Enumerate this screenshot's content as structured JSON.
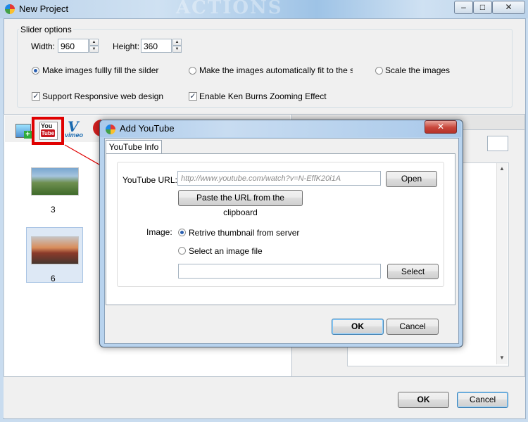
{
  "window": {
    "title": "New Project",
    "watermark": "ACTIONS",
    "controls": {
      "minimize": "–",
      "maximize": "□",
      "close": "✕"
    }
  },
  "slider_options": {
    "legend": "Slider options",
    "width_label": "Width:",
    "width_value": "960",
    "height_label": "Height:",
    "height_value": "360",
    "fit_options": [
      {
        "label": "Make images fullly fill the silder",
        "selected": true
      },
      {
        "label": "Make the images automatically fit to the slider",
        "selected": false
      },
      {
        "label": "Scale the images",
        "selected": false
      }
    ],
    "checkboxes": [
      {
        "label": "Support Responsive web design",
        "checked": true
      },
      {
        "label": "Enable Ken Burns Zooming Effect",
        "checked": true
      }
    ]
  },
  "toolbar": {
    "items": [
      {
        "name": "add-image-icon"
      },
      {
        "name": "youtube-icon",
        "you": "You",
        "tube": "Tube"
      },
      {
        "name": "vimeo-icon",
        "text": "vimeo"
      }
    ]
  },
  "thumbnails": [
    {
      "label": "3",
      "selected": false
    },
    {
      "label": "6",
      "selected": true
    }
  ],
  "main_buttons": {
    "ok": "OK",
    "cancel": "Cancel"
  },
  "dialog": {
    "title": "Add YouTube",
    "close": "✕",
    "tab": "YouTube Info",
    "url_label": "YouTube URL:",
    "url_placeholder": "http://www.youtube.com/watch?v=N-EffK20i1A",
    "open_button": "Open",
    "paste_button": "Paste the URL from the clipboard",
    "image_label": "Image:",
    "image_options": [
      {
        "label": "Retrive thumbnail from server",
        "selected": true
      },
      {
        "label": "Select an image file",
        "selected": false
      }
    ],
    "image_file_value": "",
    "select_button": "Select",
    "ok": "OK",
    "cancel": "Cancel"
  },
  "colors": {
    "highlight": "#e00000",
    "arrow": "#e00000",
    "titlebar": "#bcd3ea"
  }
}
